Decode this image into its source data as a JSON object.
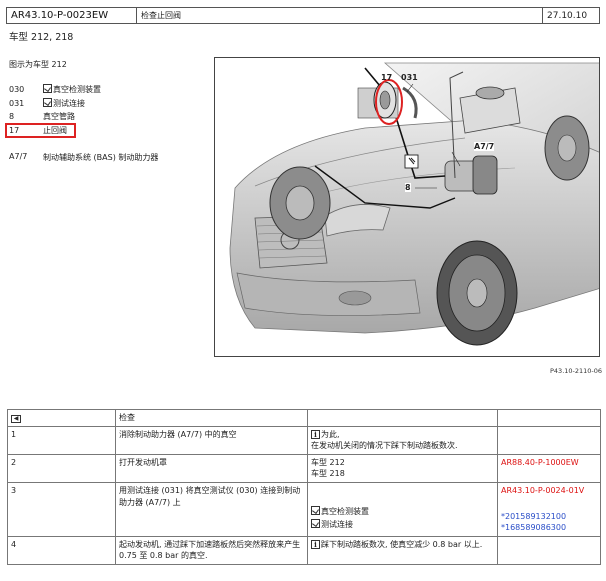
{
  "header": {
    "doc_code": "AR43.10-P-0023EW",
    "title": "检查止回阀",
    "date": "27.10.10"
  },
  "model_line": "车型 212, 218",
  "figure_caption": "图示为车型 212",
  "legend": [
    {
      "num": "030",
      "label": "真空检测装置",
      "tool_icon": true
    },
    {
      "num": "031",
      "label": "测试连接",
      "tool_icon": true
    },
    {
      "num": "8",
      "label": "真空管路",
      "tool_icon": false
    },
    {
      "num": "17",
      "label": "止回阀",
      "tool_icon": false,
      "highlighted": true
    }
  ],
  "component": {
    "num": "A7/7",
    "label": "制动辅助系统 (BAS) 制动助力器"
  },
  "illustration": {
    "callouts": [
      "17",
      "031",
      "A7/7",
      "8"
    ],
    "ref": "P43.10-2110-06"
  },
  "table": {
    "header_icon": "step-icon",
    "header": "检查",
    "rows": [
      {
        "num": "1",
        "action": "消除制动助力器 (A7/7) 中的真空",
        "note_icon": "info",
        "notes": [
          "为此,",
          "在发动机关闭的情况下踩下制动踏板数次."
        ],
        "ref": ""
      },
      {
        "num": "2",
        "action": "打开发动机罩",
        "notes": [
          "车型 212",
          "车型 218"
        ],
        "ref": "AR88.40-P-1000EW"
      },
      {
        "num": "3",
        "action": "用测试连接 (031) 将真空测试仪 (030) 连接到制动助力器 (A7/7) 上",
        "notes": [
          "真空检测装置",
          "测试连接"
        ],
        "ref": "AR43.10-P-0024-01V",
        "tool_refs": [
          "*201589132100",
          "*168589086300"
        ]
      },
      {
        "num": "4",
        "action": "起动发动机, 通过踩下加速踏板然后突然释放来产生 0.75 至 0.8 bar 的真空.",
        "note_icon": "info",
        "notes": [
          "踩下制动踏板数次, 使真空减少 0.8 bar 以上."
        ],
        "ref": ""
      }
    ]
  }
}
